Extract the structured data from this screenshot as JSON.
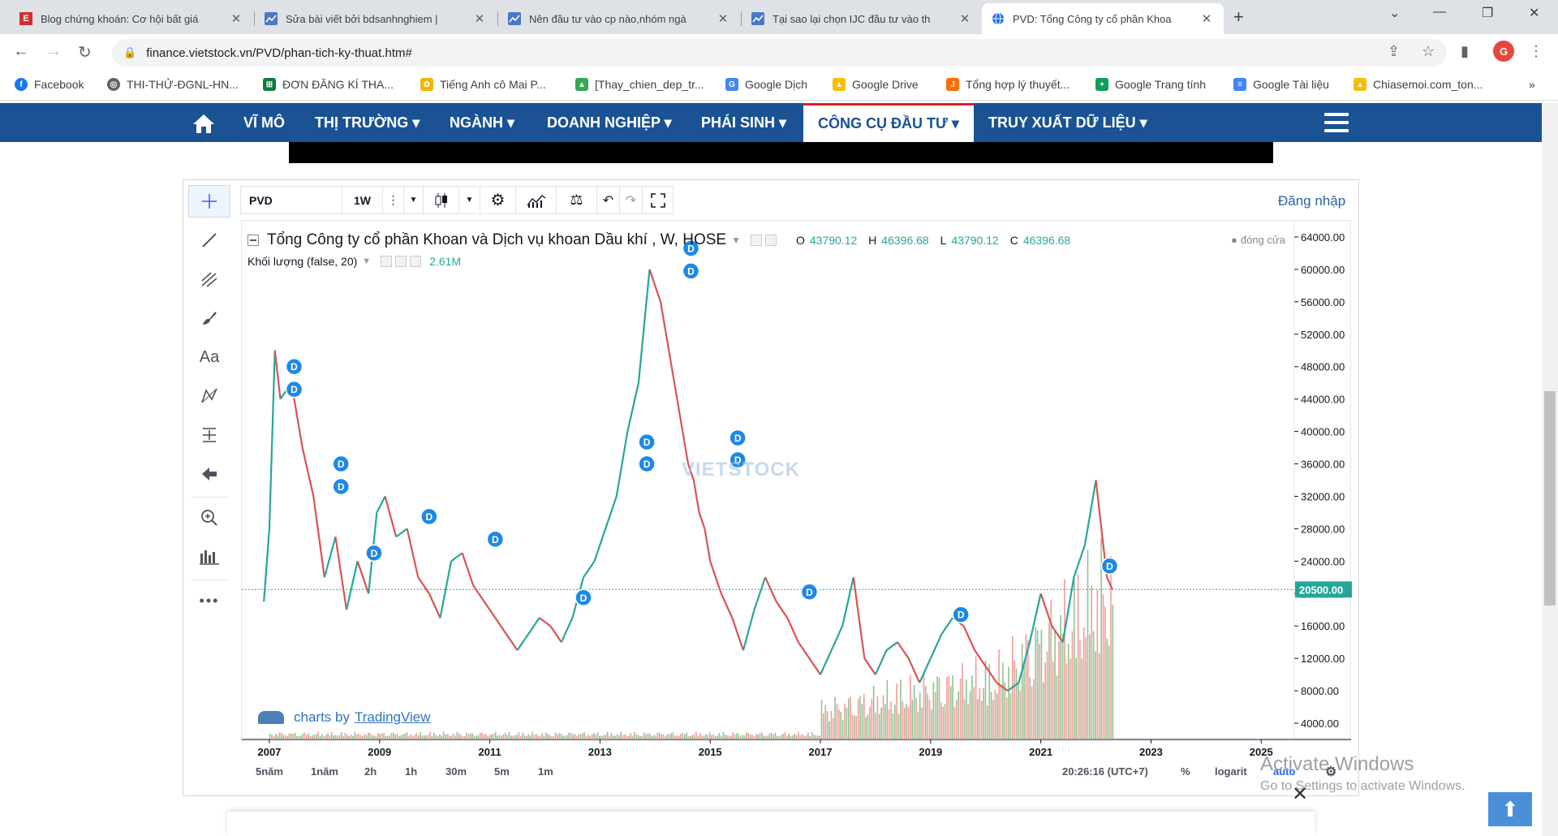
{
  "browser": {
    "tabs": [
      {
        "title": "Blog chứng khoán: Cơ hội bất giá",
        "favicon": "E",
        "favcolor": "#d32f2f"
      },
      {
        "title": "Sửa bài viết bởi bdsanhnghiem |",
        "favicon": "chart",
        "favcolor": "#4a78c8"
      },
      {
        "title": "Nên đầu tư vào cp nào,nhóm ngà",
        "favicon": "chart",
        "favcolor": "#4a78c8"
      },
      {
        "title": "Tại sao lại chọn IJC đầu tư vào th",
        "favicon": "chart",
        "favcolor": "#4a78c8"
      },
      {
        "title": "PVD: Tổng Công ty cổ phần Khoa",
        "favicon": "globe",
        "favcolor": "#1a73e8"
      }
    ],
    "url": "finance.vietstock.vn/PVD/phan-tich-ky-thuat.htm#",
    "profile_initial": "G",
    "bookmarks": [
      {
        "label": "Facebook",
        "color": "#1877f2",
        "glyph": "f"
      },
      {
        "label": "THI-THỬ-ĐGNL-HN...",
        "color": "#5f6368",
        "glyph": "◎"
      },
      {
        "label": "ĐƠN ĐĂNG KÍ THA...",
        "color": "#0f7b3c",
        "glyph": "⊞"
      },
      {
        "label": "Tiếng Anh cô Mai P...",
        "color": "#f4b400",
        "glyph": "✿"
      },
      {
        "label": "[Thay_chien_dep_tr...",
        "color": "#34a853",
        "glyph": "▲"
      },
      {
        "label": "Google Dịch",
        "color": "#4285f4",
        "glyph": "G"
      },
      {
        "label": "Google Drive",
        "color": "#fbbc04",
        "glyph": "▲"
      },
      {
        "label": "Tổng hợp lý thuyết...",
        "color": "#ff6d00",
        "glyph": "J"
      },
      {
        "label": "Google Trang tính",
        "color": "#0f9d58",
        "glyph": "+"
      },
      {
        "label": "Google Tài liệu",
        "color": "#4285f4",
        "glyph": "≡"
      },
      {
        "label": "Chiasemoi.com_ton...",
        "color": "#fbbc04",
        "glyph": "▲"
      }
    ],
    "more_bookmarks": "»"
  },
  "site_nav": {
    "items": [
      "VĨ MÔ",
      "THỊ TRƯỜNG ▾",
      "NGÀNH ▾",
      "DOANH NGHIỆP ▾",
      "PHÁI SINH ▾",
      "CÔNG CỤ ĐẦU TƯ ▾",
      "TRUY XUẤT DỮ LIỆU ▾"
    ],
    "active_index": 5
  },
  "chart_toolbar": {
    "symbol": "PVD",
    "interval": "1W",
    "login": "Đăng nhập"
  },
  "legend": {
    "title": "Tổng Công ty cổ phần Khoan và Dịch vụ khoan Dầu khí , W, HOSE",
    "o_label": "O",
    "o": "43790.12",
    "h_label": "H",
    "h": "46396.68",
    "l_label": "L",
    "l": "43790.12",
    "c_label": "C",
    "c": "46396.68",
    "volume_label": "Khối lượng (false, 20)",
    "volume_value": "2.61M",
    "closing": "đóng cửa"
  },
  "watermark": "VIETSTOCK",
  "branding": {
    "prefix": "charts by",
    "link": "TradingView"
  },
  "bottom_bar": {
    "ranges": [
      "5năm",
      "1năm",
      "2h",
      "1h",
      "30m",
      "5m",
      "1m"
    ],
    "time": "20:26:16 (UTC+7)",
    "pct": "%",
    "log": "logarit",
    "auto": "auto"
  },
  "overlay": {
    "activate_title": "Activate Windows",
    "activate_sub": "Go to Settings to activate Windows."
  },
  "chart_data": {
    "type": "line",
    "title": "Tổng Công ty cổ phần Khoan và Dịch vụ khoan Dầu khí , W, HOSE",
    "x_ticks": [
      "2007",
      "2009",
      "2011",
      "2013",
      "2015",
      "2017",
      "2019",
      "2021",
      "2023",
      "2025"
    ],
    "y_ticks": [
      4000,
      8000,
      12000,
      16000,
      20000,
      24000,
      28000,
      32000,
      36000,
      40000,
      44000,
      48000,
      52000,
      56000,
      60000,
      64000
    ],
    "y_tick_labels": [
      "4000.00",
      "8000.00",
      "12000.00",
      "16000.00",
      "20000.00",
      "24000.00",
      "28000.00",
      "32000.00",
      "36000.00",
      "40000.00",
      "44000.00",
      "48000.00",
      "52000.00",
      "56000.00",
      "60000.00",
      "64000.00"
    ],
    "ylim": [
      2000,
      66000
    ],
    "xlim": [
      2006.5,
      2025.6
    ],
    "current_price": 20500,
    "current_price_label": "20500.00",
    "price_series": {
      "x": [
        2006.9,
        2007.0,
        2007.1,
        2007.2,
        2007.4,
        2007.6,
        2007.8,
        2008.0,
        2008.2,
        2008.4,
        2008.6,
        2008.8,
        2008.95,
        2009.1,
        2009.3,
        2009.5,
        2009.7,
        2009.9,
        2010.1,
        2010.3,
        2010.5,
        2010.7,
        2010.9,
        2011.1,
        2011.3,
        2011.5,
        2011.7,
        2011.9,
        2012.1,
        2012.3,
        2012.5,
        2012.7,
        2012.9,
        2013.1,
        2013.3,
        2013.5,
        2013.7,
        2013.9,
        2014.1,
        2014.3,
        2014.5,
        2014.6,
        2014.7,
        2014.8,
        2014.9,
        2015.0,
        2015.2,
        2015.4,
        2015.6,
        2015.8,
        2016.0,
        2016.2,
        2016.4,
        2016.6,
        2016.8,
        2017.0,
        2017.2,
        2017.4,
        2017.6,
        2017.8,
        2018.0,
        2018.2,
        2018.4,
        2018.6,
        2018.8,
        2019.0,
        2019.2,
        2019.4,
        2019.6,
        2019.8,
        2020.0,
        2020.2,
        2020.4,
        2020.6,
        2020.8,
        2021.0,
        2021.2,
        2021.4,
        2021.6,
        2021.8,
        2022.0,
        2022.1,
        2022.2,
        2022.3
      ],
      "y": [
        19000,
        28000,
        50000,
        44000,
        46000,
        38000,
        32000,
        22000,
        27000,
        18000,
        24000,
        20000,
        30000,
        32000,
        27000,
        28000,
        22000,
        20000,
        17000,
        24000,
        25000,
        21000,
        19000,
        17000,
        15000,
        13000,
        15000,
        17000,
        16000,
        14000,
        17000,
        22000,
        24000,
        28000,
        32000,
        40000,
        46000,
        60000,
        56000,
        48000,
        40000,
        36000,
        34000,
        30000,
        28000,
        24000,
        20000,
        17000,
        13000,
        18000,
        22000,
        19000,
        17000,
        14000,
        12000,
        10000,
        13000,
        16000,
        22000,
        12000,
        10000,
        13000,
        14000,
        12000,
        9000,
        12000,
        15000,
        17000,
        16000,
        13000,
        11000,
        9000,
        8000,
        9000,
        14000,
        20000,
        16000,
        14000,
        22000,
        26000,
        34000,
        28000,
        22000,
        20500
      ]
    },
    "dividend_markers": [
      {
        "x": 2007.45,
        "y": 48000,
        "label": "D"
      },
      {
        "x": 2007.45,
        "y": 45200,
        "label": "D"
      },
      {
        "x": 2008.3,
        "y": 36000,
        "label": "D"
      },
      {
        "x": 2008.3,
        "y": 33200,
        "label": "D"
      },
      {
        "x": 2008.9,
        "y": 25000,
        "label": "D"
      },
      {
        "x": 2009.9,
        "y": 29500,
        "label": "D"
      },
      {
        "x": 2011.1,
        "y": 26700,
        "label": "D"
      },
      {
        "x": 2012.7,
        "y": 19500,
        "label": "D"
      },
      {
        "x": 2013.85,
        "y": 38700,
        "label": "D"
      },
      {
        "x": 2013.85,
        "y": 36000,
        "label": "D"
      },
      {
        "x": 2014.65,
        "y": 62600,
        "label": "D"
      },
      {
        "x": 2014.65,
        "y": 59800,
        "label": "D"
      },
      {
        "x": 2015.5,
        "y": 39200,
        "label": "D"
      },
      {
        "x": 2015.5,
        "y": 36500,
        "label": "D"
      },
      {
        "x": 2016.8,
        "y": 20200,
        "label": "D"
      },
      {
        "x": 2019.55,
        "y": 17400,
        "label": "D"
      },
      {
        "x": 2022.25,
        "y": 23400,
        "label": "D"
      }
    ],
    "volume_note": "volume bars rise strongly from 2017 to 2022"
  }
}
